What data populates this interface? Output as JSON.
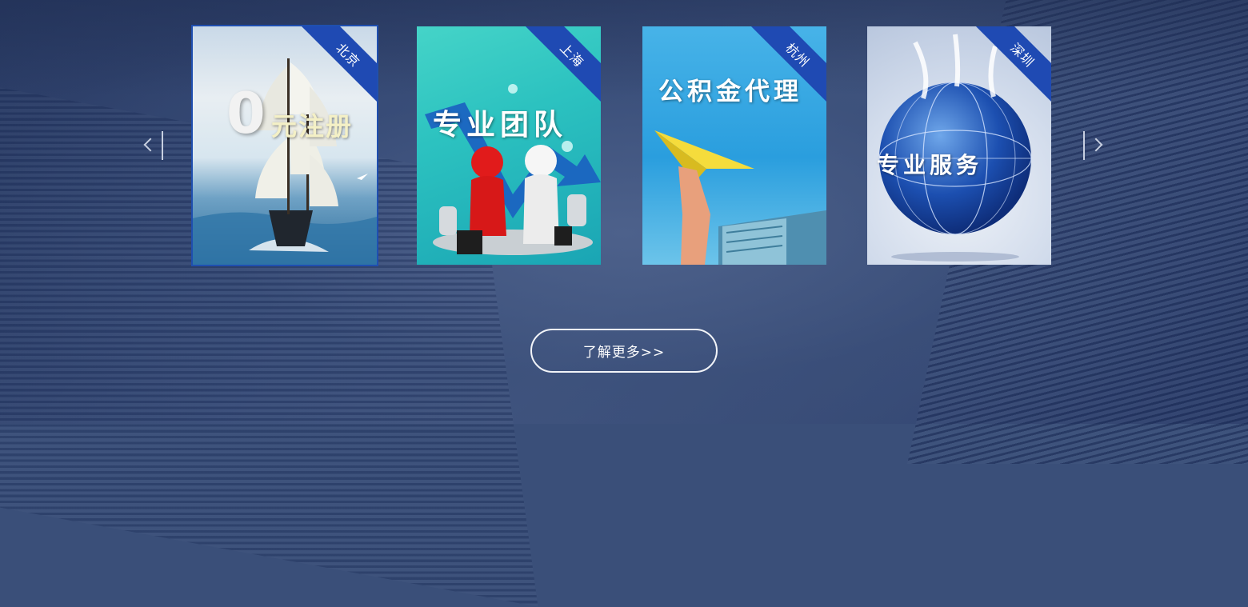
{
  "carousel": {
    "prev_icon": "chevron-left-icon",
    "next_icon": "chevron-right-icon",
    "cards": [
      {
        "city": "北京",
        "headline_prefix": "0",
        "headline": "元注册",
        "illustration": "sailing-ship"
      },
      {
        "city": "上海",
        "headline": "专业团队",
        "illustration": "handshake-figures"
      },
      {
        "city": "杭州",
        "headline": "公积金代理",
        "illustration": "paper-plane"
      },
      {
        "city": "深圳",
        "headline": "专业服务",
        "illustration": "globe"
      }
    ],
    "ribbon_color": "#1f4ab3",
    "active_index": 0
  },
  "more_button": {
    "label": "了解更多>>"
  }
}
